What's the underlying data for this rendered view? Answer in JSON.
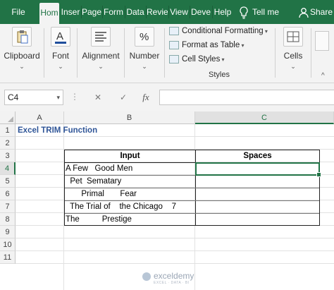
{
  "tabs": {
    "file": "File",
    "home": "Hom",
    "insert": "Inser",
    "page_layout": "Page",
    "formulas": "Form",
    "data": "Data",
    "review": "Revie",
    "view": "View",
    "developer": "Deve",
    "help": "Help",
    "tell_me": "Tell me",
    "share": "Share"
  },
  "ribbon": {
    "clipboard": "Clipboard",
    "font": "Font",
    "alignment": "Alignment",
    "number": "Number",
    "conditional_formatting": "Conditional Formatting",
    "format_as_table": "Format as Table",
    "cell_styles": "Cell Styles",
    "styles_group": "Styles",
    "cells": "Cells"
  },
  "formula_bar": {
    "name_box": "C4",
    "cancel_glyph": "✕",
    "enter_glyph": "✓",
    "fx_glyph": "fx",
    "formula": ""
  },
  "sheet": {
    "columns": [
      "A",
      "B",
      "C"
    ],
    "rows": [
      "1",
      "2",
      "3",
      "4",
      "5",
      "6",
      "7",
      "8",
      "9",
      "10",
      "11"
    ],
    "title": "Excel TRIM Function",
    "header_input": "Input",
    "header_spaces": "Spaces",
    "inputs": [
      "A Few   Good Men",
      "  Pet  Sematary",
      "       Primal       Fear",
      "  The Trial of    the Chicago    7",
      "The          Prestige"
    ]
  },
  "watermark": {
    "name": "exceldemy",
    "tagline": "EXCEL · DATA · BI"
  },
  "colors": {
    "excel_green": "#217346",
    "title_blue": "#2f5597"
  }
}
